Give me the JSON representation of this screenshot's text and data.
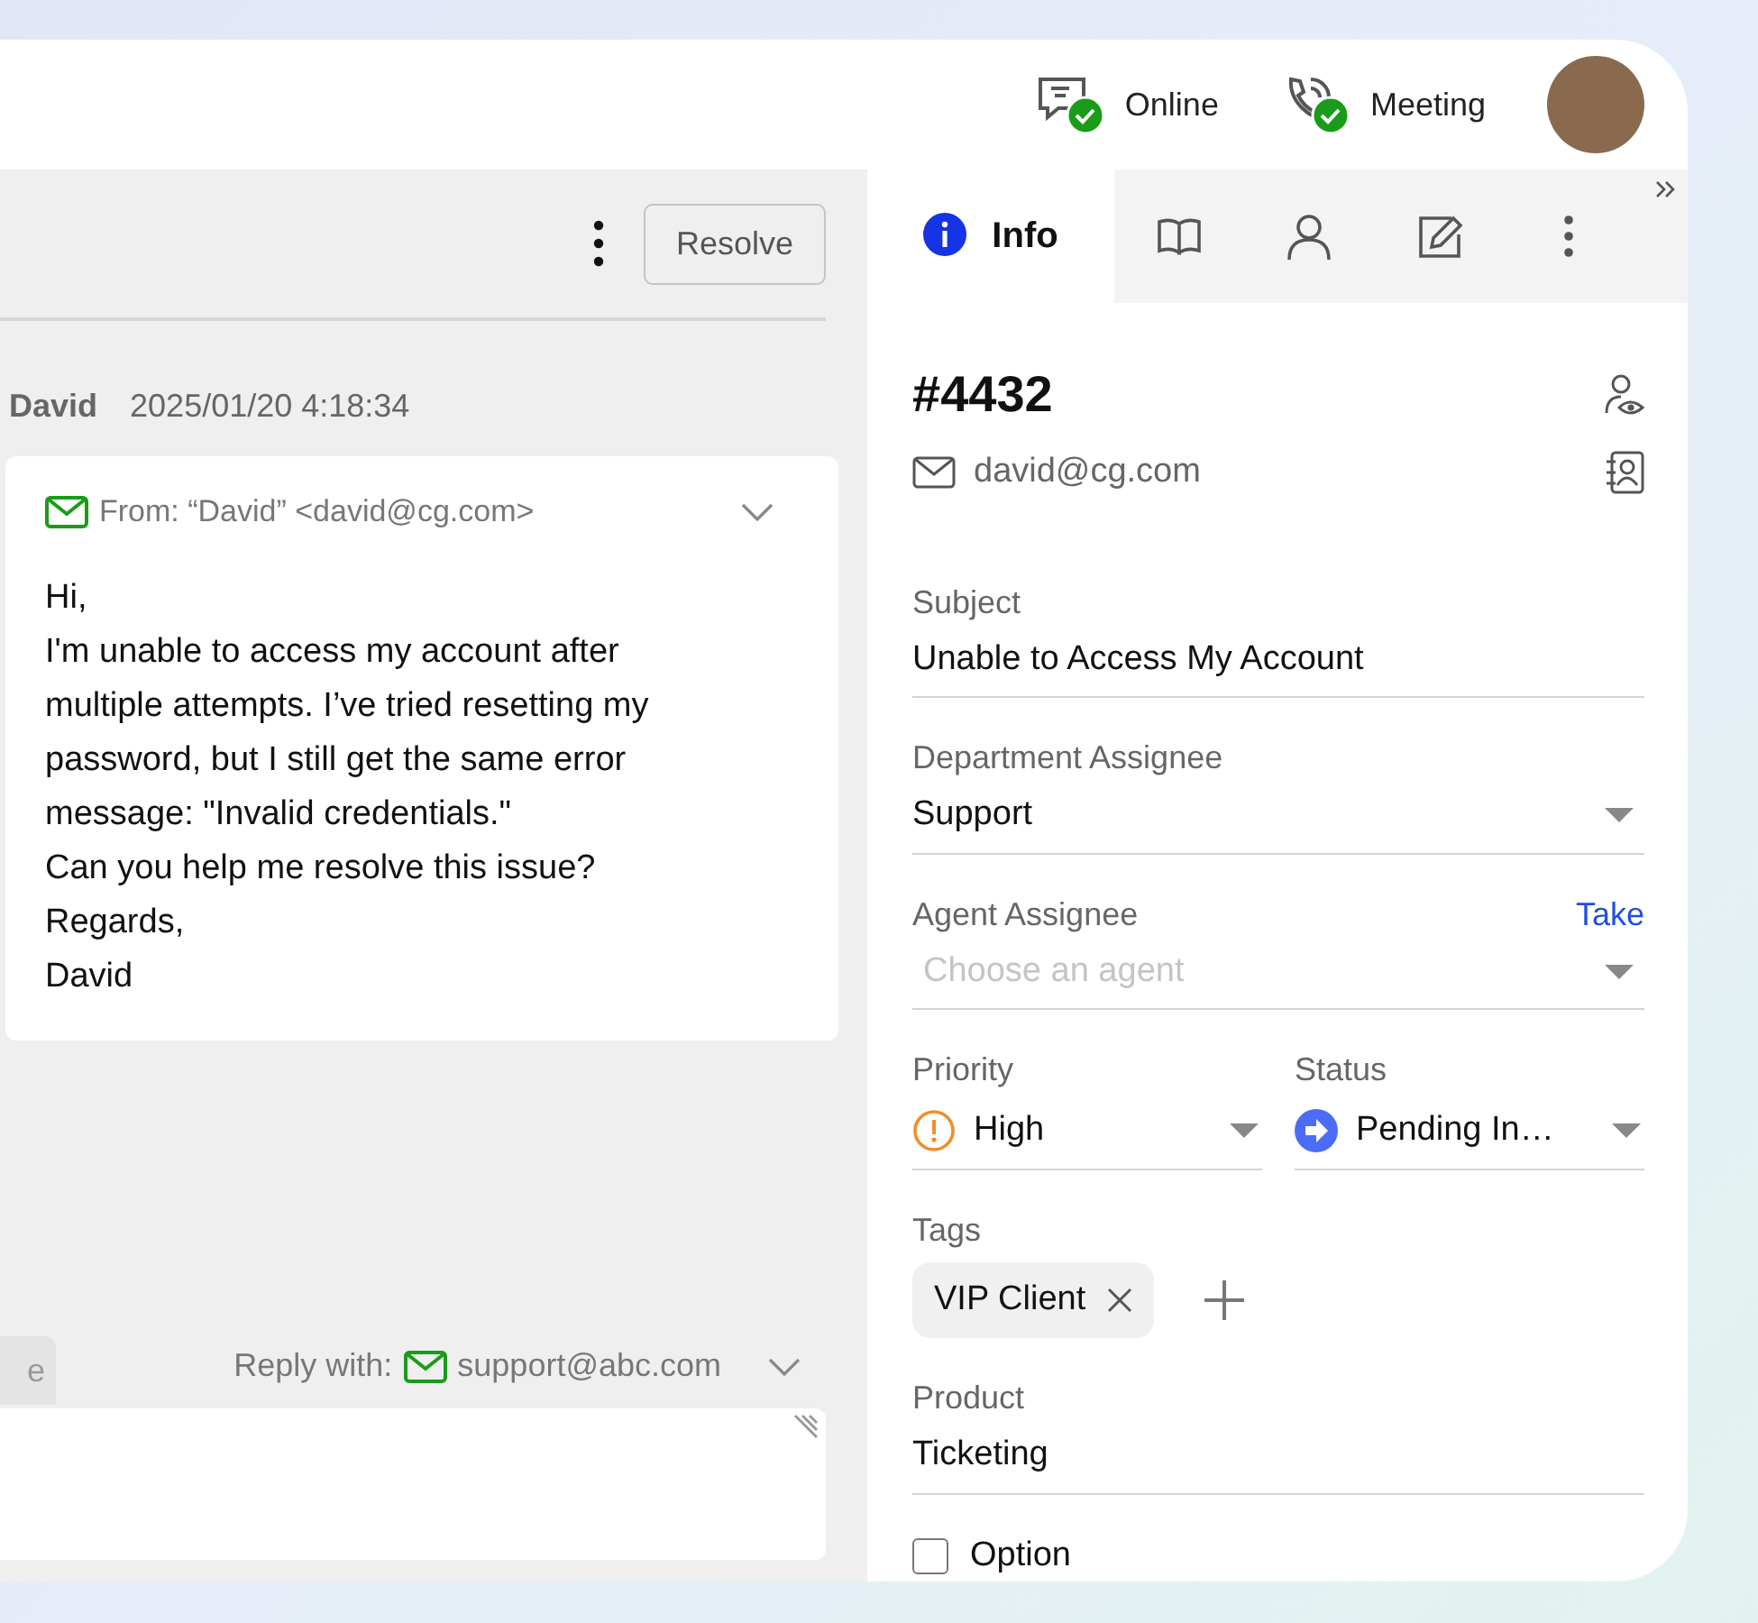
{
  "top_bar": {
    "statuses": [
      {
        "kind": "chat",
        "label": "Online"
      },
      {
        "kind": "phone",
        "label": "Meeting"
      }
    ]
  },
  "conversation": {
    "resolve_button": "Resolve",
    "message": {
      "sender": "David",
      "time": "2025/01/20 4:18:34",
      "from": "From: “David” <david@cg.com>",
      "paragraphs": [
        "Hi,",
        "I'm unable to access my account after multiple attempts. I’ve tried resetting my password, but I still get the same error message: \"Invalid credentials.\"",
        "Can you help me resolve this issue?",
        "Regards,",
        "David"
      ]
    },
    "reply": {
      "tab_label": "e",
      "label": "Reply with:",
      "address": "support@abc.com"
    }
  },
  "details": {
    "tabs": [
      {
        "kind": "info",
        "label": "Info",
        "selected": true
      },
      {
        "kind": "book",
        "selected": false
      },
      {
        "kind": "person",
        "selected": false
      },
      {
        "kind": "edit",
        "selected": false
      },
      {
        "kind": "more",
        "selected": false
      }
    ],
    "ticket_number": "#4432",
    "email": "david@cg.com",
    "fields": [
      {
        "kind": "text",
        "label": "Subject",
        "value": "Unable to Access My Account"
      },
      {
        "kind": "select",
        "label": "Department Assignee",
        "value": "Support"
      },
      {
        "kind": "select",
        "label": "Agent Assignee",
        "action": "Take",
        "placeholder": "Choose an agent"
      },
      {
        "kind": "pair",
        "items": [
          {
            "kind": "priority",
            "label": "Priority",
            "value": "High"
          },
          {
            "kind": "status",
            "label": "Status",
            "value": "Pending In…"
          }
        ]
      },
      {
        "kind": "tags",
        "label": "Tags",
        "tags": [
          "VIP Client"
        ]
      },
      {
        "kind": "text",
        "label": "Product",
        "value": "Ticketing"
      },
      {
        "kind": "checkbox",
        "label": "Option",
        "checked": false
      }
    ]
  }
}
